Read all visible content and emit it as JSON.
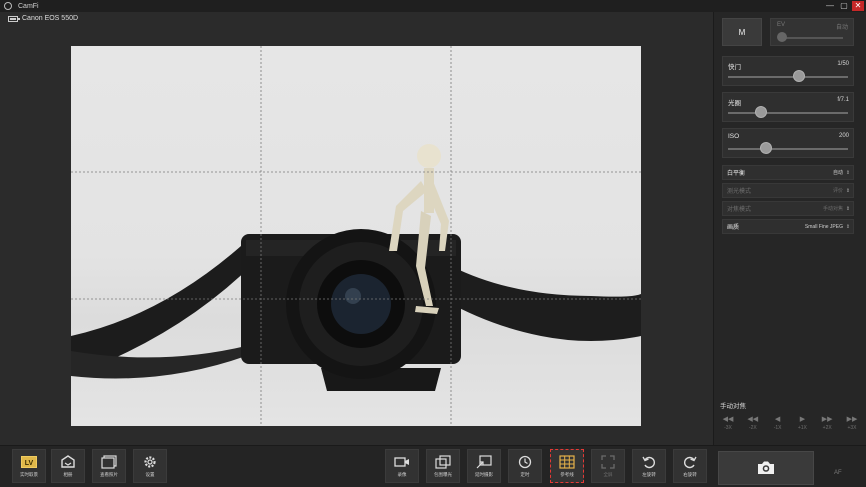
{
  "window": {
    "title": "CamFi"
  },
  "camera": {
    "name": "Canon EOS 550D",
    "battery_level": 0.7
  },
  "settings": {
    "mode": "M",
    "ev": {
      "label": "EV",
      "value": "自动",
      "level": 0.0
    },
    "shutter": {
      "label": "快门",
      "value": "1/50",
      "level": 0.6
    },
    "aperture": {
      "label": "光圈",
      "value": "f/7.1",
      "level": 0.25
    },
    "iso": {
      "label": "ISO",
      "value": "200",
      "level": 0.3
    },
    "white_balance": {
      "label": "白平衡",
      "value": "自动"
    },
    "metering": {
      "label": "测光模式",
      "value": "评价"
    },
    "focus_mode": {
      "label": "对焦模式",
      "value": "手动对焦"
    },
    "quality": {
      "label": "画质",
      "value": "Small Fine JPEG"
    }
  },
  "manual_focus": {
    "title": "手动对焦",
    "steps": [
      "-3X",
      "-2X",
      "-1X",
      "+1X",
      "+2X",
      "+3X"
    ]
  },
  "toolbar": {
    "left": [
      {
        "label": "实时取景",
        "icon": "live-view-icon"
      },
      {
        "label": "相册",
        "icon": "album-icon"
      },
      {
        "label": "查看照片",
        "icon": "gallery-icon"
      },
      {
        "label": "设置",
        "icon": "gear-icon"
      }
    ],
    "right": [
      {
        "label": "录像",
        "icon": "video-icon"
      },
      {
        "label": "包围曝光",
        "icon": "bracketing-icon"
      },
      {
        "label": "延时摄影",
        "icon": "timelapse-icon"
      },
      {
        "label": "定时",
        "icon": "timer-icon"
      },
      {
        "label": "参考线",
        "icon": "grid-icon",
        "active": true
      },
      {
        "label": "全屏",
        "icon": "fullscreen-icon",
        "disabled": true
      },
      {
        "label": "左旋转",
        "icon": "rotate-left-icon"
      },
      {
        "label": "右旋转",
        "icon": "rotate-right-icon"
      }
    ],
    "shutter_icon": "camera-shutter-icon",
    "af_label": "AF"
  },
  "colors": {
    "active_outline": "#e53935",
    "close_button": "#c62828"
  }
}
